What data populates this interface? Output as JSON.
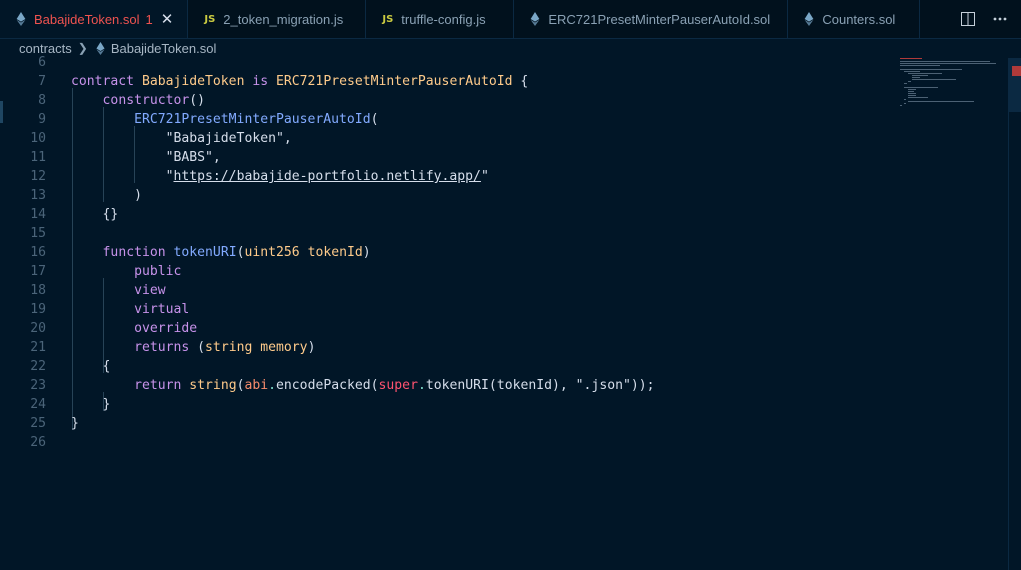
{
  "tabs": [
    {
      "label": "BabajideToken.sol",
      "icon": "solidity-icon",
      "active": true,
      "dirty_count": "1",
      "close": "✕"
    },
    {
      "label": "2_token_migration.js",
      "icon": "js-icon",
      "icon_text": "JS"
    },
    {
      "label": "truffle-config.js",
      "icon": "js-icon",
      "icon_text": "JS"
    },
    {
      "label": "ERC721PresetMinterPauserAutoId.sol",
      "icon": "solidity-icon"
    },
    {
      "label": "Counters.sol",
      "icon": "solidity-icon"
    }
  ],
  "breadcrumb": {
    "folder": "contracts",
    "file": "BabajideToken.sol"
  },
  "code": {
    "line_numbers": [
      "6",
      "7",
      "8",
      "9",
      "10",
      "11",
      "12",
      "13",
      "14",
      "15",
      "16",
      "17",
      "18",
      "19",
      "20",
      "21",
      "22",
      "23",
      "24",
      "25",
      "26"
    ],
    "l7": {
      "kw": "contract",
      "name": "BabajideToken",
      "is": "is",
      "parent": "ERC721PresetMinterPauserAutoId",
      "brace": "{"
    },
    "l8": {
      "kw": "constructor",
      "paren": "()"
    },
    "l9": {
      "fn": "ERC721PresetMinterPauserAutoId",
      "paren": "("
    },
    "l10": {
      "str": "\"BabajideToken\"",
      "comma": ","
    },
    "l11": {
      "str": "\"BABS\"",
      "comma": ","
    },
    "l12": {
      "q1": "\"",
      "url": "https://babajide-portfolio.netlify.app/",
      "q2": "\""
    },
    "l13": {
      "text": ")"
    },
    "l14": {
      "text": "{}"
    },
    "l16": {
      "kw": "function",
      "fn": "tokenURI",
      "p1": "(",
      "type": "uint256",
      "param": "tokenId",
      "p2": ")"
    },
    "l17": {
      "text": "public"
    },
    "l18": {
      "text": "view"
    },
    "l19": {
      "text": "virtual"
    },
    "l20": {
      "text": "override"
    },
    "l21": {
      "kw": "returns",
      "p1": "(",
      "type": "string",
      "mem": "memory",
      "p2": ")"
    },
    "l22": {
      "text": "{"
    },
    "l23": {
      "kw": "return",
      "type": "string",
      "p1": "(",
      "abi": "abi",
      "dot1": ".",
      "enc": "encodePacked",
      "p2": "(",
      "sup": "super",
      "dot2": ".",
      "fn": "tokenURI",
      "p3": "(",
      "arg": "tokenId",
      "p4": "),",
      "str": "\".json\"",
      "end": "));"
    },
    "l24": {
      "text": "}"
    },
    "l25": {
      "text": "}"
    }
  },
  "colors": {
    "background": "#011627",
    "keyword": "#c792ea",
    "function": "#82aaff",
    "string": "#ecc48d",
    "active_tab": "#ef5350"
  }
}
